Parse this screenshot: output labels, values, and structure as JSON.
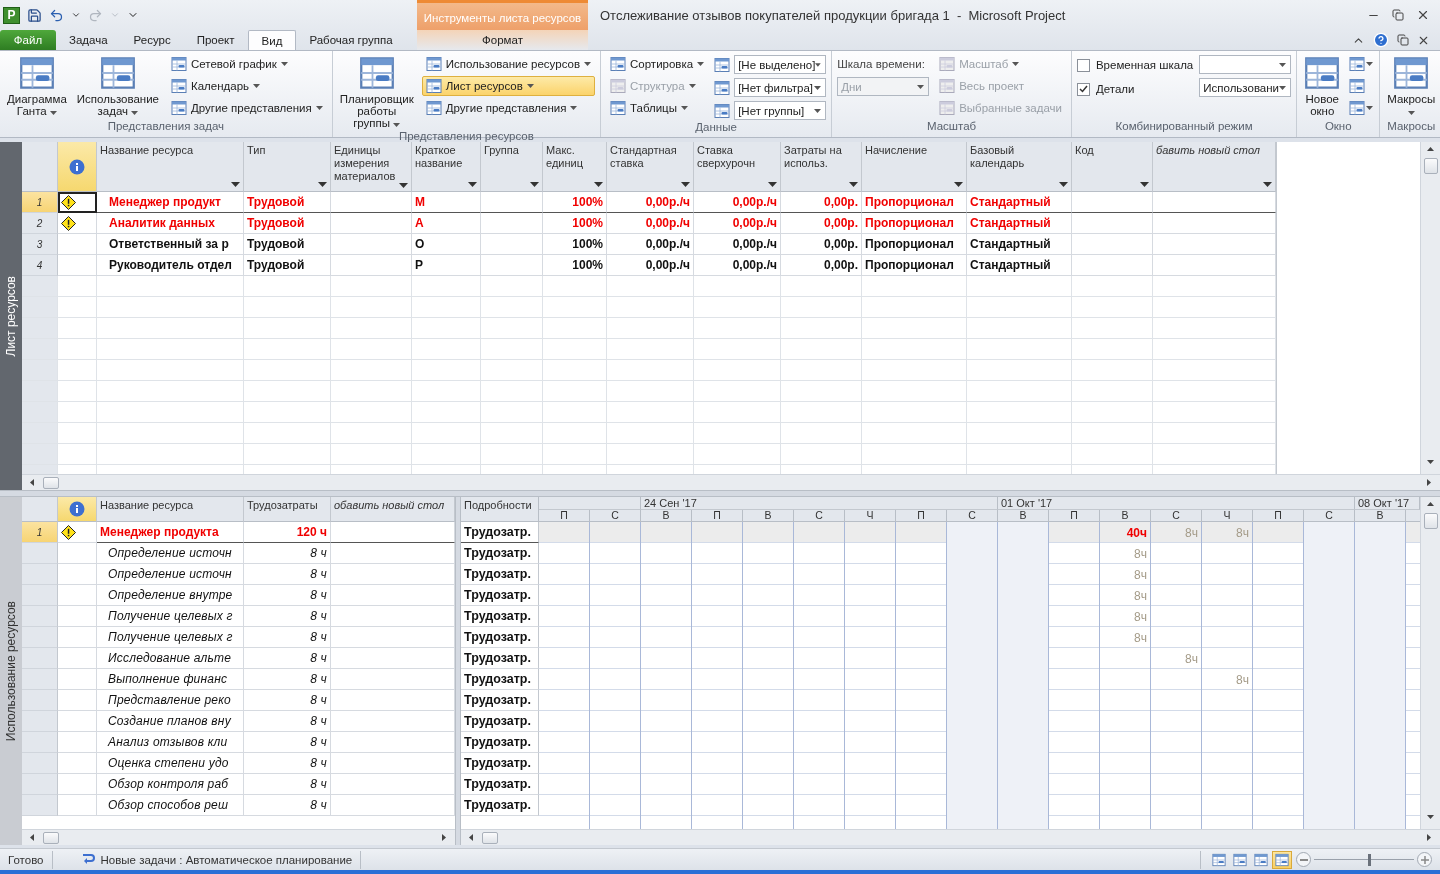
{
  "app": {
    "logo": "P",
    "title": "Отслеживание отзывов покупателей продукции бригада 1  -  Microsoft Project"
  },
  "context": {
    "title": "Инструменты листа ресурсов",
    "tab": {
      "label": "Формат",
      "selected": false
    }
  },
  "tabs": [
    {
      "label": "Файл",
      "kind": "file",
      "selected": false
    },
    {
      "label": "Задача",
      "kind": "tab",
      "selected": false
    },
    {
      "label": "Ресурс",
      "kind": "tab",
      "selected": false
    },
    {
      "label": "Проект",
      "kind": "tab",
      "selected": false
    },
    {
      "label": "Вид",
      "kind": "tab",
      "selected": true
    },
    {
      "label": "Рабочая группа",
      "kind": "tab",
      "selected": false
    }
  ],
  "ribbon": [
    {
      "label": "Представления задач",
      "columns": [
        [
          {
            "kind": "large",
            "label": "Диаграмма\nГанта",
            "menu": true,
            "disabled": false
          }
        ],
        [
          {
            "kind": "large",
            "label": "Использование\nзадач",
            "menu": true,
            "disabled": false
          }
        ],
        [
          {
            "kind": "small",
            "label": "Сетевой график",
            "menu": true,
            "disabled": false,
            "selected": false
          },
          {
            "kind": "small",
            "label": "Календарь",
            "menu": true,
            "disabled": false,
            "selected": false
          },
          {
            "kind": "small",
            "label": "Другие представления",
            "menu": true,
            "disabled": false,
            "selected": false
          }
        ]
      ]
    },
    {
      "label": "Представления ресурсов",
      "columns": [
        [
          {
            "kind": "large",
            "label": "Планировщик\nработы группы",
            "menu": true,
            "disabled": false
          }
        ],
        [
          {
            "kind": "small",
            "label": "Использование ресурсов",
            "menu": true,
            "disabled": false,
            "selected": false
          },
          {
            "kind": "small",
            "label": "Лист ресурсов",
            "menu": true,
            "disabled": false,
            "selected": true
          },
          {
            "kind": "small",
            "label": "Другие представления",
            "menu": true,
            "disabled": false,
            "selected": false
          }
        ]
      ]
    },
    {
      "label": "Данные",
      "columns": [
        [
          {
            "kind": "small",
            "label": "Сортировка",
            "menu": true,
            "disabled": false,
            "selected": false
          },
          {
            "kind": "small",
            "label": "Структура",
            "menu": true,
            "disabled": true,
            "selected": false
          },
          {
            "kind": "small",
            "label": "Таблицы",
            "menu": true,
            "disabled": false,
            "selected": false
          }
        ],
        [
          {
            "kind": "icon_select",
            "value": "[Не выделено]",
            "disabled": false
          },
          {
            "kind": "icon_select",
            "value": "[Нет фильтра]",
            "disabled": false
          },
          {
            "kind": "icon_select",
            "value": "[Нет группы]",
            "disabled": false
          }
        ]
      ]
    },
    {
      "label": "Масштаб",
      "columns": [
        [
          {
            "kind": "label",
            "label": "Шкала времени:",
            "disabled": false
          },
          {
            "kind": "select",
            "value": "Дни",
            "disabled": true
          }
        ],
        [
          {
            "kind": "small",
            "label": "Масштаб",
            "menu": true,
            "disabled": true,
            "selected": false
          },
          {
            "kind": "small",
            "label": "Весь проект",
            "menu": false,
            "disabled": true,
            "selected": false
          },
          {
            "kind": "small",
            "label": "Выбранные задачи",
            "menu": false,
            "disabled": true,
            "selected": false
          }
        ]
      ]
    },
    {
      "label": "Комбинированный режим",
      "columns": [
        [
          {
            "kind": "checkbox",
            "label": "Временная шкала",
            "checked": false,
            "disabled": false
          },
          {
            "kind": "checkbox",
            "label": "Детали",
            "checked": true,
            "disabled": false
          }
        ],
        [
          {
            "kind": "select",
            "disabled": false
          },
          {
            "kind": "select",
            "value": "Использовани",
            "disabled": false
          }
        ]
      ]
    },
    {
      "label": "Окно",
      "columns": [
        [
          {
            "kind": "large",
            "label": "Новое\nокно",
            "menu": false,
            "disabled": false
          }
        ],
        [
          {
            "kind": "icon",
            "menu": true,
            "disabled": false
          },
          {
            "kind": "icon",
            "menu": false,
            "disabled": false
          },
          {
            "kind": "icon",
            "menu": true,
            "disabled": false
          }
        ]
      ]
    },
    {
      "label": "Макросы",
      "columns": [
        [
          {
            "kind": "large",
            "label": "Макросы",
            "menu": true,
            "disabled": false
          }
        ]
      ]
    }
  ],
  "sheet": {
    "pane_label": "Лист ресурсов",
    "active": true,
    "columns": [
      {
        "kind": "text",
        "label": "Название ресурса"
      },
      {
        "kind": "text",
        "label": "Тип"
      },
      {
        "kind": "text",
        "label": "Единицы измерения материалов"
      },
      {
        "kind": "text",
        "label": "Краткое название"
      },
      {
        "kind": "text",
        "label": "Группа"
      },
      {
        "kind": "number",
        "label": "Макс. единиц"
      },
      {
        "kind": "number",
        "label": "Стандартная ставка"
      },
      {
        "kind": "number",
        "label": "Ставка сверхурочн"
      },
      {
        "kind": "number",
        "label": "Затраты на использ."
      },
      {
        "kind": "text",
        "label": "Начисление"
      },
      {
        "kind": "text",
        "label": "Базовый календарь"
      },
      {
        "kind": "text",
        "label": "Код"
      },
      {
        "kind": "add",
        "label": "бавить новый стол"
      }
    ],
    "rows": [
      {
        "id": "1",
        "selected": true,
        "warning": true,
        "overallocated": true,
        "cells": [
          "Менеджер продукт",
          "Трудовой",
          null,
          "М",
          null,
          "100%",
          "0,00р./ч",
          "0,00р./ч",
          "0,00р.",
          "Пропорционал",
          "Стандартный",
          null,
          null
        ]
      },
      {
        "id": "2",
        "selected": false,
        "warning": true,
        "overallocated": true,
        "cells": [
          "Аналитик данных",
          "Трудовой",
          null,
          "А",
          null,
          "100%",
          "0,00р./ч",
          "0,00р./ч",
          "0,00р.",
          "Пропорционал",
          "Стандартный",
          null,
          null
        ]
      },
      {
        "id": "3",
        "selected": false,
        "warning": false,
        "overallocated": false,
        "cells": [
          "Ответственный за р",
          "Трудовой",
          null,
          "О",
          null,
          "100%",
          "0,00р./ч",
          "0,00р./ч",
          "0,00р.",
          "Пропорционал",
          "Стандартный",
          null,
          null
        ]
      },
      {
        "id": "4",
        "selected": false,
        "warning": false,
        "overallocated": false,
        "cells": [
          "Руководитель отдел",
          "Трудовой",
          null,
          "Р",
          null,
          "100%",
          "0,00р./ч",
          "0,00р./ч",
          "0,00р.",
          "Пропорционал",
          "Стандартный",
          null,
          null
        ]
      }
    ]
  },
  "usage": {
    "pane_label": "Использование ресурсов",
    "active": false,
    "columns": [
      {
        "kind": "text",
        "label": "Название ресурса"
      },
      {
        "kind": "number",
        "label": "Трудозатраты"
      },
      {
        "kind": "add",
        "label": "обавить новый стол"
      }
    ],
    "details_header": "Подробности",
    "weeks": [
      {
        "days": [
          {
            "label": "П",
            "weekend": false
          },
          {
            "label": "С",
            "weekend": false
          }
        ]
      },
      {
        "label": "24 Сен '17",
        "days": [
          {
            "label": "В",
            "weekend": false
          },
          {
            "label": "П",
            "weekend": false
          },
          {
            "label": "В",
            "weekend": false
          },
          {
            "label": "С",
            "weekend": false
          },
          {
            "label": "Ч",
            "weekend": false
          },
          {
            "label": "П",
            "weekend": false
          },
          {
            "label": "С",
            "weekend": true
          }
        ]
      },
      {
        "label": "01 Окт '17",
        "days": [
          {
            "label": "В",
            "weekend": true
          },
          {
            "label": "П",
            "weekend": false
          },
          {
            "label": "В",
            "weekend": false
          },
          {
            "label": "С",
            "weekend": false
          },
          {
            "label": "Ч",
            "weekend": false
          },
          {
            "label": "П",
            "weekend": false
          },
          {
            "label": "С",
            "weekend": true
          }
        ]
      },
      {
        "label": "08 Окт '17",
        "days": [
          {
            "label": "В",
            "weekend": true
          }
        ]
      }
    ],
    "rows": [
      {
        "kind": "resource",
        "id": "1",
        "selected": true,
        "warning": true,
        "overallocated": true,
        "name": "Менеджер продукта",
        "work": "120 ч",
        "details": "Трудозатр.",
        "cells": [
          null,
          null,
          null,
          null,
          null,
          null,
          null,
          null,
          null,
          null,
          null,
          {
            "text": "40ч",
            "overallocated": true
          },
          {
            "text": "8ч",
            "overallocated": false
          },
          {
            "text": "8ч",
            "overallocated": false
          },
          null,
          null,
          null
        ]
      },
      {
        "kind": "assignment",
        "selected": false,
        "name": "Определение источн",
        "work": "8 ч",
        "details": "Трудозатр.",
        "cells": [
          null,
          null,
          null,
          null,
          null,
          null,
          null,
          null,
          null,
          null,
          null,
          {
            "text": "8ч",
            "overallocated": false
          },
          null,
          null,
          null,
          null,
          null
        ]
      },
      {
        "kind": "assignment",
        "selected": false,
        "name": "Определение источн",
        "work": "8 ч",
        "details": "Трудозатр.",
        "cells": [
          null,
          null,
          null,
          null,
          null,
          null,
          null,
          null,
          null,
          null,
          null,
          {
            "text": "8ч",
            "overallocated": false
          },
          null,
          null,
          null,
          null,
          null
        ]
      },
      {
        "kind": "assignment",
        "selected": false,
        "name": "Определение внутре",
        "work": "8 ч",
        "details": "Трудозатр.",
        "cells": [
          null,
          null,
          null,
          null,
          null,
          null,
          null,
          null,
          null,
          null,
          null,
          {
            "text": "8ч",
            "overallocated": false
          },
          null,
          null,
          null,
          null,
          null
        ]
      },
      {
        "kind": "assignment",
        "selected": false,
        "name": "Получение целевых г",
        "work": "8 ч",
        "details": "Трудозатр.",
        "cells": [
          null,
          null,
          null,
          null,
          null,
          null,
          null,
          null,
          null,
          null,
          null,
          {
            "text": "8ч",
            "overallocated": false
          },
          null,
          null,
          null,
          null,
          null
        ]
      },
      {
        "kind": "assignment",
        "selected": false,
        "name": "Получение целевых г",
        "work": "8 ч",
        "details": "Трудозатр.",
        "cells": [
          null,
          null,
          null,
          null,
          null,
          null,
          null,
          null,
          null,
          null,
          null,
          {
            "text": "8ч",
            "overallocated": false
          },
          null,
          null,
          null,
          null,
          null
        ]
      },
      {
        "kind": "assignment",
        "selected": false,
        "name": "Исследование альте",
        "work": "8 ч",
        "details": "Трудозатр.",
        "cells": [
          null,
          null,
          null,
          null,
          null,
          null,
          null,
          null,
          null,
          null,
          null,
          null,
          {
            "text": "8ч",
            "overallocated": false
          },
          null,
          null,
          null,
          null
        ]
      },
      {
        "kind": "assignment",
        "selected": false,
        "name": "Выполнение финанс",
        "work": "8 ч",
        "details": "Трудозатр.",
        "cells": [
          null,
          null,
          null,
          null,
          null,
          null,
          null,
          null,
          null,
          null,
          null,
          null,
          null,
          {
            "text": "8ч",
            "overallocated": false
          },
          null,
          null,
          null
        ]
      },
      {
        "kind": "assignment",
        "selected": false,
        "name": "Представление реко",
        "work": "8 ч",
        "details": "Трудозатр.",
        "cells": [
          null,
          null,
          null,
          null,
          null,
          null,
          null,
          null,
          null,
          null,
          null,
          null,
          null,
          null,
          null,
          null,
          null
        ]
      },
      {
        "kind": "assignment",
        "selected": false,
        "name": "Создание планов вну",
        "work": "8 ч",
        "details": "Трудозатр.",
        "cells": [
          null,
          null,
          null,
          null,
          null,
          null,
          null,
          null,
          null,
          null,
          null,
          null,
          null,
          null,
          null,
          null,
          null
        ]
      },
      {
        "kind": "assignment",
        "selected": false,
        "name": "Анализ отзывов кли",
        "work": "8 ч",
        "details": "Трудозатр.",
        "cells": [
          null,
          null,
          null,
          null,
          null,
          null,
          null,
          null,
          null,
          null,
          null,
          null,
          null,
          null,
          null,
          null,
          null
        ]
      },
      {
        "kind": "assignment",
        "selected": false,
        "name": "Оценка степени удо",
        "work": "8 ч",
        "details": "Трудозатр.",
        "cells": [
          null,
          null,
          null,
          null,
          null,
          null,
          null,
          null,
          null,
          null,
          null,
          null,
          null,
          null,
          null,
          null,
          null
        ]
      },
      {
        "kind": "assignment",
        "selected": false,
        "name": "Обзор контроля раб",
        "work": "8 ч",
        "details": "Трудозатр.",
        "cells": [
          null,
          null,
          null,
          null,
          null,
          null,
          null,
          null,
          null,
          null,
          null,
          null,
          null,
          null,
          null,
          null,
          null
        ]
      },
      {
        "kind": "assignment",
        "selected": false,
        "name": "Обзор способов реш",
        "work": "8 ч",
        "details": "Трудозатр.",
        "cells": [
          null,
          null,
          null,
          null,
          null,
          null,
          null,
          null,
          null,
          null,
          null,
          null,
          null,
          null,
          null,
          null,
          null
        ]
      }
    ]
  },
  "status_bar": {
    "ready": "Готово",
    "mode": "Новые задачи : Автоматическое планирование",
    "views": [
      {
        "selected": false
      },
      {
        "selected": false
      },
      {
        "selected": false
      },
      {
        "selected": true
      }
    ],
    "zoom": {
      "level": 0.55
    }
  }
}
